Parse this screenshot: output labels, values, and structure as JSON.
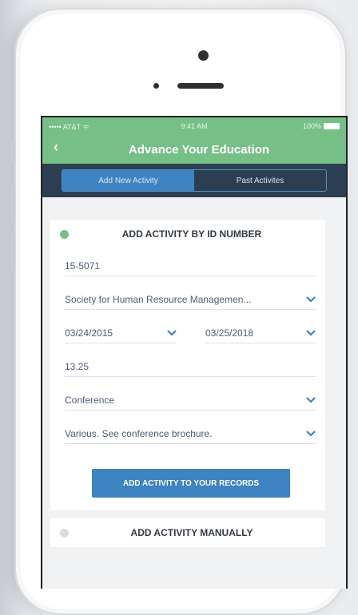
{
  "status_bar": {
    "carrier": "••••• AT&T ᯤ",
    "time": "9:41 AM",
    "battery": "100%"
  },
  "nav": {
    "back_label": "‹",
    "title": "Advance Your Education"
  },
  "tabs": [
    {
      "label": "Add New Activity",
      "active": true
    },
    {
      "label": "Past Activites",
      "active": false
    }
  ],
  "id_section": {
    "title": "ADD ACTIVITY BY ID NUMBER",
    "status_color": "#76bf86",
    "id_number": "15-5071",
    "organization": "Society for Human Resource Managemen...",
    "start_date": "03/24/2015",
    "end_date": "03/25/2018",
    "credits": "13.25",
    "type": "Conference",
    "location": "Various. See conference brochure.",
    "submit_label": "ADD ACTIVITY TO YOUR RECORDS"
  },
  "manual_section": {
    "title": "ADD ACTIVITY MANUALLY",
    "status_color": "#d9dbde"
  },
  "colors": {
    "brand_green": "#76bf86",
    "navy": "#2c3f52",
    "accent_blue": "#3e83c2",
    "field_text": "#4a5d7a"
  },
  "icons": [
    "back-chevron-icon",
    "chevron-down-icon",
    "wifi-icon",
    "battery-icon"
  ]
}
